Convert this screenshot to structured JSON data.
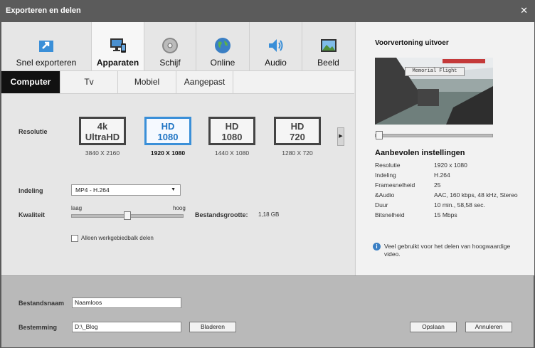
{
  "window": {
    "title": "Exporteren en delen"
  },
  "top_tabs": [
    {
      "label": "Snel exporteren",
      "icon": "quick-export-icon"
    },
    {
      "label": "Apparaten",
      "icon": "devices-icon",
      "active": true
    },
    {
      "label": "Schijf",
      "icon": "disc-icon"
    },
    {
      "label": "Online",
      "icon": "globe-icon"
    },
    {
      "label": "Audio",
      "icon": "speaker-icon"
    },
    {
      "label": "Beeld",
      "icon": "image-icon"
    }
  ],
  "sub_tabs": [
    {
      "label": "Computer",
      "active": true
    },
    {
      "label": "Tv"
    },
    {
      "label": "Mobiel"
    },
    {
      "label": "Aangepast"
    }
  ],
  "resolution": {
    "label": "Resolutie",
    "options": [
      {
        "line1": "4k",
        "line2": "UltraHD",
        "size": "3840 X 2160"
      },
      {
        "line1": "HD",
        "line2": "1080",
        "size": "1920 X 1080",
        "active": true
      },
      {
        "line1": "HD",
        "line2": "1080",
        "size": "1440 X 1080"
      },
      {
        "line1": "HD",
        "line2": "720",
        "size": "1280 X 720"
      }
    ]
  },
  "format": {
    "label": "Indeling",
    "value": "MP4 - H.264"
  },
  "quality": {
    "label": "Kwaliteit",
    "low": "laag",
    "high": "hoog",
    "level": 0.5
  },
  "filesize": {
    "label": "Bestandsgrootte:",
    "value": "1,18 GB"
  },
  "workarea_checkbox": {
    "label": "Alleen werkgebiedbalk delen",
    "checked": false
  },
  "preview": {
    "title": "Voorvertoning uitvoer",
    "overlay_text": "Memorial Flight",
    "position": 0
  },
  "recommended": {
    "title": "Aanbevolen instellingen",
    "rows": [
      {
        "key": "Resolutie",
        "value": "1920 x 1080"
      },
      {
        "key": "Indeling",
        "value": "H.264"
      },
      {
        "key": "Framesnelheid",
        "value": "25"
      },
      {
        "key": "&Audio",
        "value": "AAC, 160 kbps, 48 kHz, Stereo"
      },
      {
        "key": "Duur",
        "value": "10 min., 58,58 sec."
      },
      {
        "key": "Bitsnelheid",
        "value": "15 Mbps"
      }
    ],
    "info": "Veel gebruikt voor het delen van hoogwaardige video."
  },
  "bottom": {
    "filename_label": "Bestandsnaam",
    "filename_value": "Naamloos",
    "destination_label": "Bestemming",
    "destination_value": "D:\\_Blog",
    "browse": "Bladeren",
    "save": "Opslaan",
    "cancel": "Annuleren"
  },
  "colors": {
    "accent": "#3a8fd8",
    "titlebar": "#5b5b5b",
    "active_subtab": "#111111"
  }
}
